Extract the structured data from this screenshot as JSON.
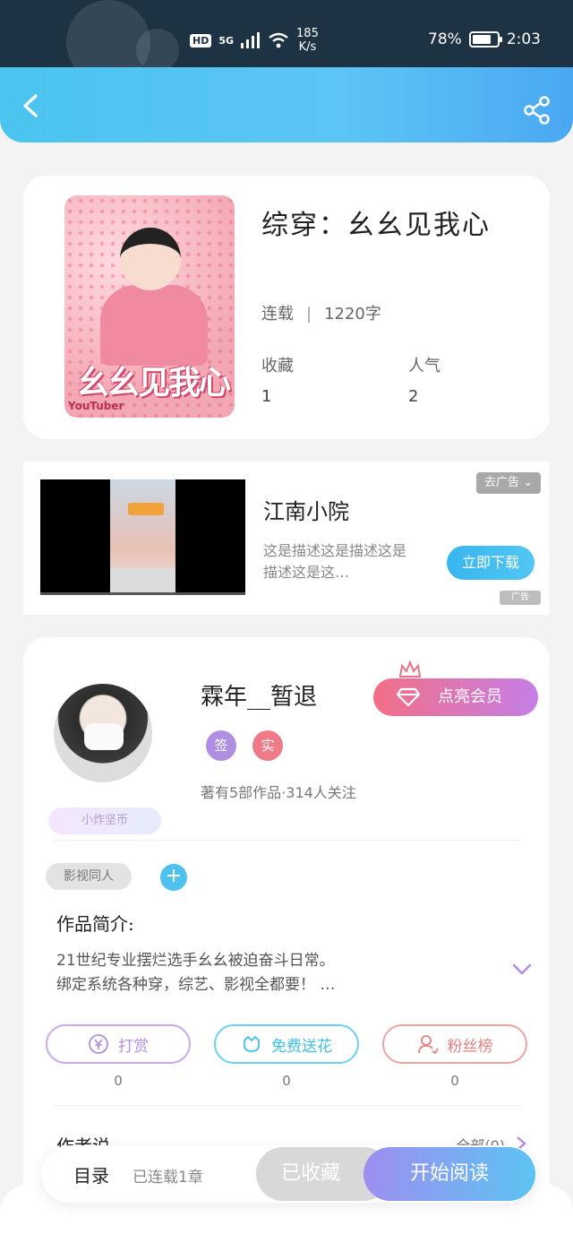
{
  "status_bar": {
    "hd": "HD",
    "network": "5G",
    "speed_value": "185",
    "speed_unit": "K/s",
    "battery": "78%",
    "battery_level": 0.78,
    "time": "2:03"
  },
  "book": {
    "title": "综穿：幺幺见我心",
    "status": "连载",
    "word_count": "1220字",
    "favorites_label": "收藏",
    "favorites_value": "1",
    "popularity_label": "人气",
    "popularity_value": "2",
    "cover_text": "幺幺见我心",
    "cover_brand": "YouTuber"
  },
  "ad": {
    "title": "江南小院",
    "description": "这是描述这是描述这是描述这是这…",
    "close_label": "去广告",
    "download_label": "立即下载",
    "badge": "广告"
  },
  "author": {
    "name": "霖年__暂退",
    "vip_label": "点亮会员",
    "tag_sign": "签",
    "tag_real": "实",
    "stats": "著有5部作品·314人关注",
    "fan_badge": "小炸坚币",
    "genre_tag": "影视同人",
    "add_tag": "+",
    "intro_label": "作品简介:",
    "intro_line1": "21世纪专业摆烂选手幺幺被迫奋斗日常。",
    "intro_line2": "绑定系统各种穿，综艺、影视全都要！ …",
    "tip_label": "打赏",
    "tip_count": "0",
    "flower_label": "免费送花",
    "flower_count": "0",
    "fans_label": "粉丝榜",
    "fans_count": "0",
    "author_says_label": "作者说",
    "all_comments": "全部(0)"
  },
  "bottom_bar": {
    "toc_label": "目录",
    "chapter_status": "已连载1章",
    "collected_label": "已收藏",
    "read_label": "开始阅读"
  },
  "colors": {
    "header_blue": "#4bc4f0",
    "tip_purple": "#b48ee3",
    "flower_cyan": "#3cc2e8",
    "fans_red": "#e58080"
  }
}
